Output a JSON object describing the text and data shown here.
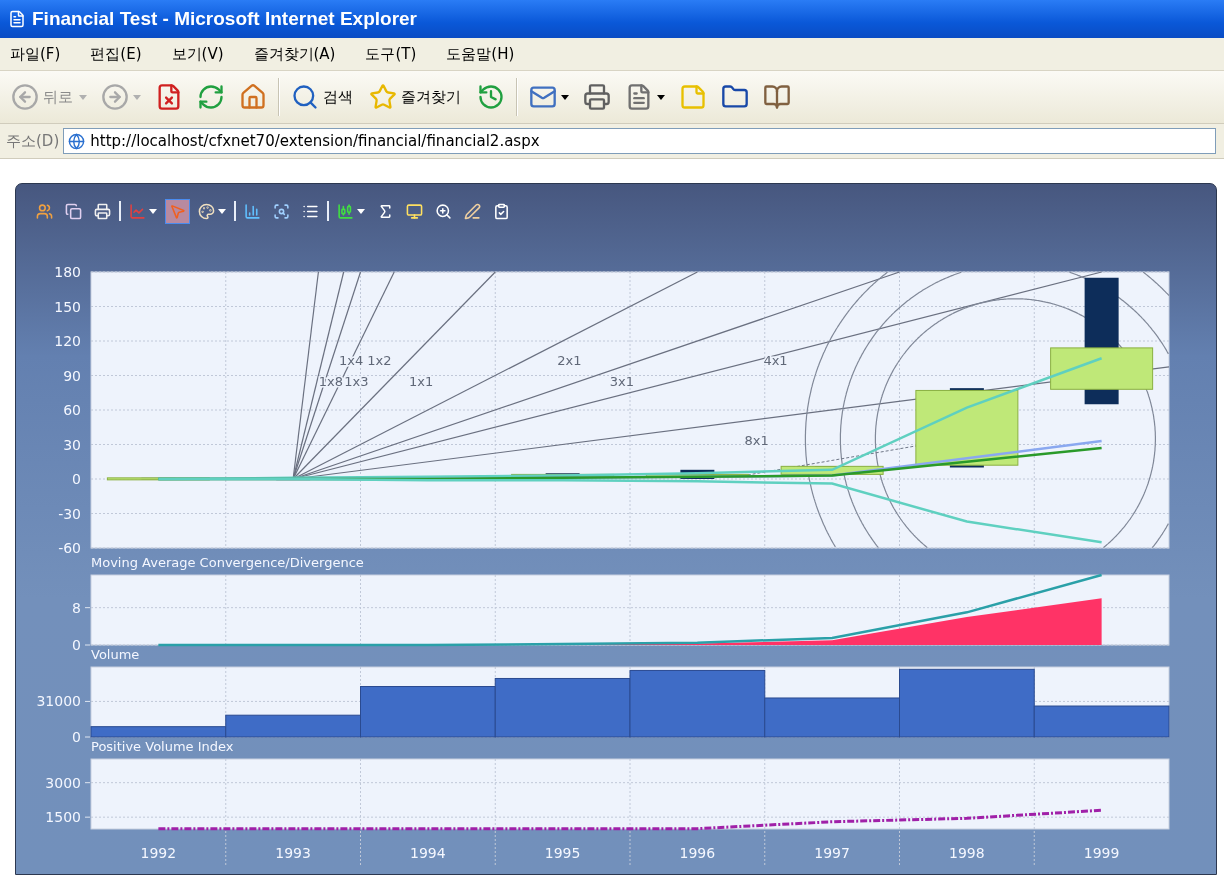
{
  "window": {
    "title": "Financial Test - Microsoft Internet Explorer"
  },
  "menu": [
    "파일(F)",
    "편집(E)",
    "보기(V)",
    "즐겨찾기(A)",
    "도구(T)",
    "도움말(H)"
  ],
  "toolbar": [
    {
      "kind": "button",
      "label": "뒤로",
      "dropdown": true,
      "disabled": true
    },
    {
      "kind": "button",
      "dropdown": true,
      "disabled": true
    },
    {
      "kind": "button",
      "dropdown": false,
      "disabled": false
    },
    {
      "kind": "button",
      "dropdown": false,
      "disabled": false
    },
    {
      "kind": "button",
      "dropdown": false,
      "disabled": false
    },
    {
      "kind": "separator"
    },
    {
      "kind": "button",
      "label": "검색",
      "dropdown": false,
      "disabled": false
    },
    {
      "kind": "button",
      "label": "즐겨찾기",
      "dropdown": false,
      "disabled": false
    },
    {
      "kind": "button",
      "dropdown": false,
      "disabled": false
    },
    {
      "kind": "separator"
    },
    {
      "kind": "button",
      "dropdown": true,
      "disabled": false
    },
    {
      "kind": "button",
      "dropdown": false,
      "disabled": false
    },
    {
      "kind": "button",
      "dropdown": true,
      "disabled": false
    },
    {
      "kind": "button",
      "dropdown": false,
      "disabled": false
    },
    {
      "kind": "button",
      "dropdown": false,
      "disabled": false
    },
    {
      "kind": "button",
      "dropdown": false,
      "disabled": false
    }
  ],
  "address": {
    "label": "주소(D)",
    "url": "http://localhost/cfxnet70/extension/financial/financial2.aspx"
  },
  "chart_toolbar": [
    {
      "kind": "button",
      "selected": false,
      "dropdown": false
    },
    {
      "kind": "button",
      "selected": false,
      "dropdown": false
    },
    {
      "kind": "button",
      "selected": false,
      "dropdown": false
    },
    {
      "kind": "separator"
    },
    {
      "kind": "button",
      "selected": false,
      "dropdown": true
    },
    {
      "kind": "button",
      "selected": true,
      "dropdown": false
    },
    {
      "kind": "button",
      "selected": false,
      "dropdown": true
    },
    {
      "kind": "separator"
    },
    {
      "kind": "button",
      "selected": false,
      "dropdown": false
    },
    {
      "kind": "button",
      "selected": false,
      "dropdown": false
    },
    {
      "kind": "button",
      "selected": false,
      "dropdown": false
    },
    {
      "kind": "separator"
    },
    {
      "kind": "button",
      "selected": false,
      "dropdown": true
    },
    {
      "kind": "button",
      "selected": false,
      "dropdown": false
    },
    {
      "kind": "button",
      "selected": false,
      "dropdown": false
    },
    {
      "kind": "button",
      "selected": false,
      "dropdown": false
    },
    {
      "kind": "button",
      "selected": false,
      "dropdown": false
    },
    {
      "kind": "button",
      "selected": false,
      "dropdown": false
    }
  ],
  "panes": [
    {
      "kind": "price",
      "y_ticks": [
        "180",
        "150",
        "120",
        "90",
        "60",
        "30",
        "0",
        "-30",
        "-60"
      ],
      "fan_labels": [
        "1x8",
        "1x4",
        "1x3",
        "1x2",
        "1x1",
        "2x1",
        "3x1",
        "4x1",
        "8x1"
      ]
    },
    {
      "kind": "indicator",
      "title": "Moving Average Convergence/Divergence",
      "chart_data": {
        "type": "area",
        "ylim": [
          0,
          15
        ],
        "yticks": [
          0,
          8
        ],
        "grid": true,
        "series": [
          {
            "color": "#ff3366",
            "values": [
              0,
              0,
              0,
              0.1,
              0.3,
              1,
              6,
              10
            ]
          },
          {
            "type": "line",
            "color": "#2aa0a8",
            "values": [
              0,
              0,
              0,
              0.2,
              0.5,
              1.5,
              7,
              15
            ]
          }
        ]
      }
    },
    {
      "kind": "indicator",
      "title": "Volume",
      "chart_data": {
        "type": "bar",
        "ylim": [
          0,
          61000
        ],
        "yticks": [
          0,
          31000
        ],
        "grid": true,
        "series": [
          {
            "color": "#3f6cc6",
            "values": [
              9000,
              19000,
              44000,
              51000,
              58000,
              34000,
              59000,
              27000
            ]
          }
        ]
      }
    },
    {
      "kind": "indicator",
      "title": "Positive Volume Index",
      "chart_data": {
        "type": "line",
        "categories": [
          "1992",
          "1993",
          "1994",
          "1995",
          "1996",
          "1997",
          "1998",
          "1999"
        ],
        "ylim": [
          985,
          4030
        ],
        "yticks": [
          1500,
          3000
        ],
        "grid": true,
        "series": [
          {
            "color": "#a020a8",
            "line_style": "dashdot",
            "values": [
              1000,
              1000,
              1000,
              1000,
              1000,
              1300,
              1450,
              1800
            ]
          }
        ]
      }
    }
  ]
}
